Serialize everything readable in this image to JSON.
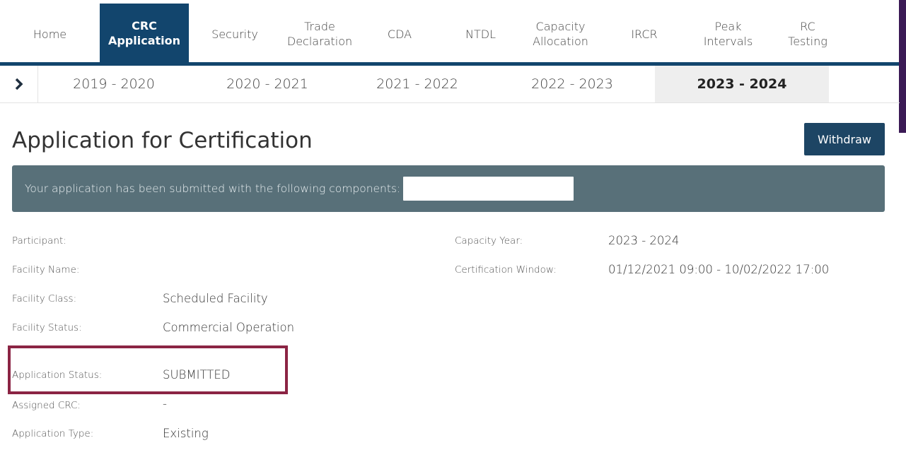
{
  "nav": {
    "tabs": [
      {
        "label": "Home"
      },
      {
        "label": "CRC\nApplication",
        "active": true
      },
      {
        "label": "Security"
      },
      {
        "label": "Trade\nDeclaration"
      },
      {
        "label": "CDA"
      },
      {
        "label": "NTDL"
      },
      {
        "label": "Capacity\nAllocation"
      },
      {
        "label": "IRCR"
      },
      {
        "label": "Peak\nIntervals"
      },
      {
        "label": "RC\nTesting"
      }
    ]
  },
  "years": {
    "arrow_icon": "chevron-right-icon",
    "items": [
      {
        "label": "2019 - 2020"
      },
      {
        "label": "2020 - 2021"
      },
      {
        "label": "2021 - 2022"
      },
      {
        "label": "2022 - 2023"
      },
      {
        "label": "2023 - 2024",
        "active": true
      }
    ]
  },
  "page": {
    "title": "Application for Certification",
    "withdraw_label": "Withdraw"
  },
  "banner": {
    "message": "Your application has been submitted with the following components:",
    "components_value": ""
  },
  "details": {
    "participant_label": "Participant:",
    "participant_value": "",
    "facility_name_label": "Facility Name:",
    "facility_name_value": "",
    "facility_class_label": "Facility Class:",
    "facility_class_value": "Scheduled Facility",
    "facility_status_label": "Facility Status:",
    "facility_status_value": "Commercial Operation",
    "application_status_label": "Application Status:",
    "application_status_value": "SUBMITTED",
    "assigned_crc_label": "Assigned CRC:",
    "assigned_crc_value": "-",
    "application_type_label": "Application Type:",
    "application_type_value": "Existing",
    "capacity_year_label": "Capacity Year:",
    "capacity_year_value": "2023 - 2024",
    "certification_window_label": "Certification Window:",
    "certification_window_value": "01/12/2021 09:00 - 10/02/2022 17:00"
  },
  "colors": {
    "nav_active": "#12456d",
    "banner": "#587079",
    "withdraw_button": "#1d4564",
    "highlight_border": "#8b2444"
  }
}
